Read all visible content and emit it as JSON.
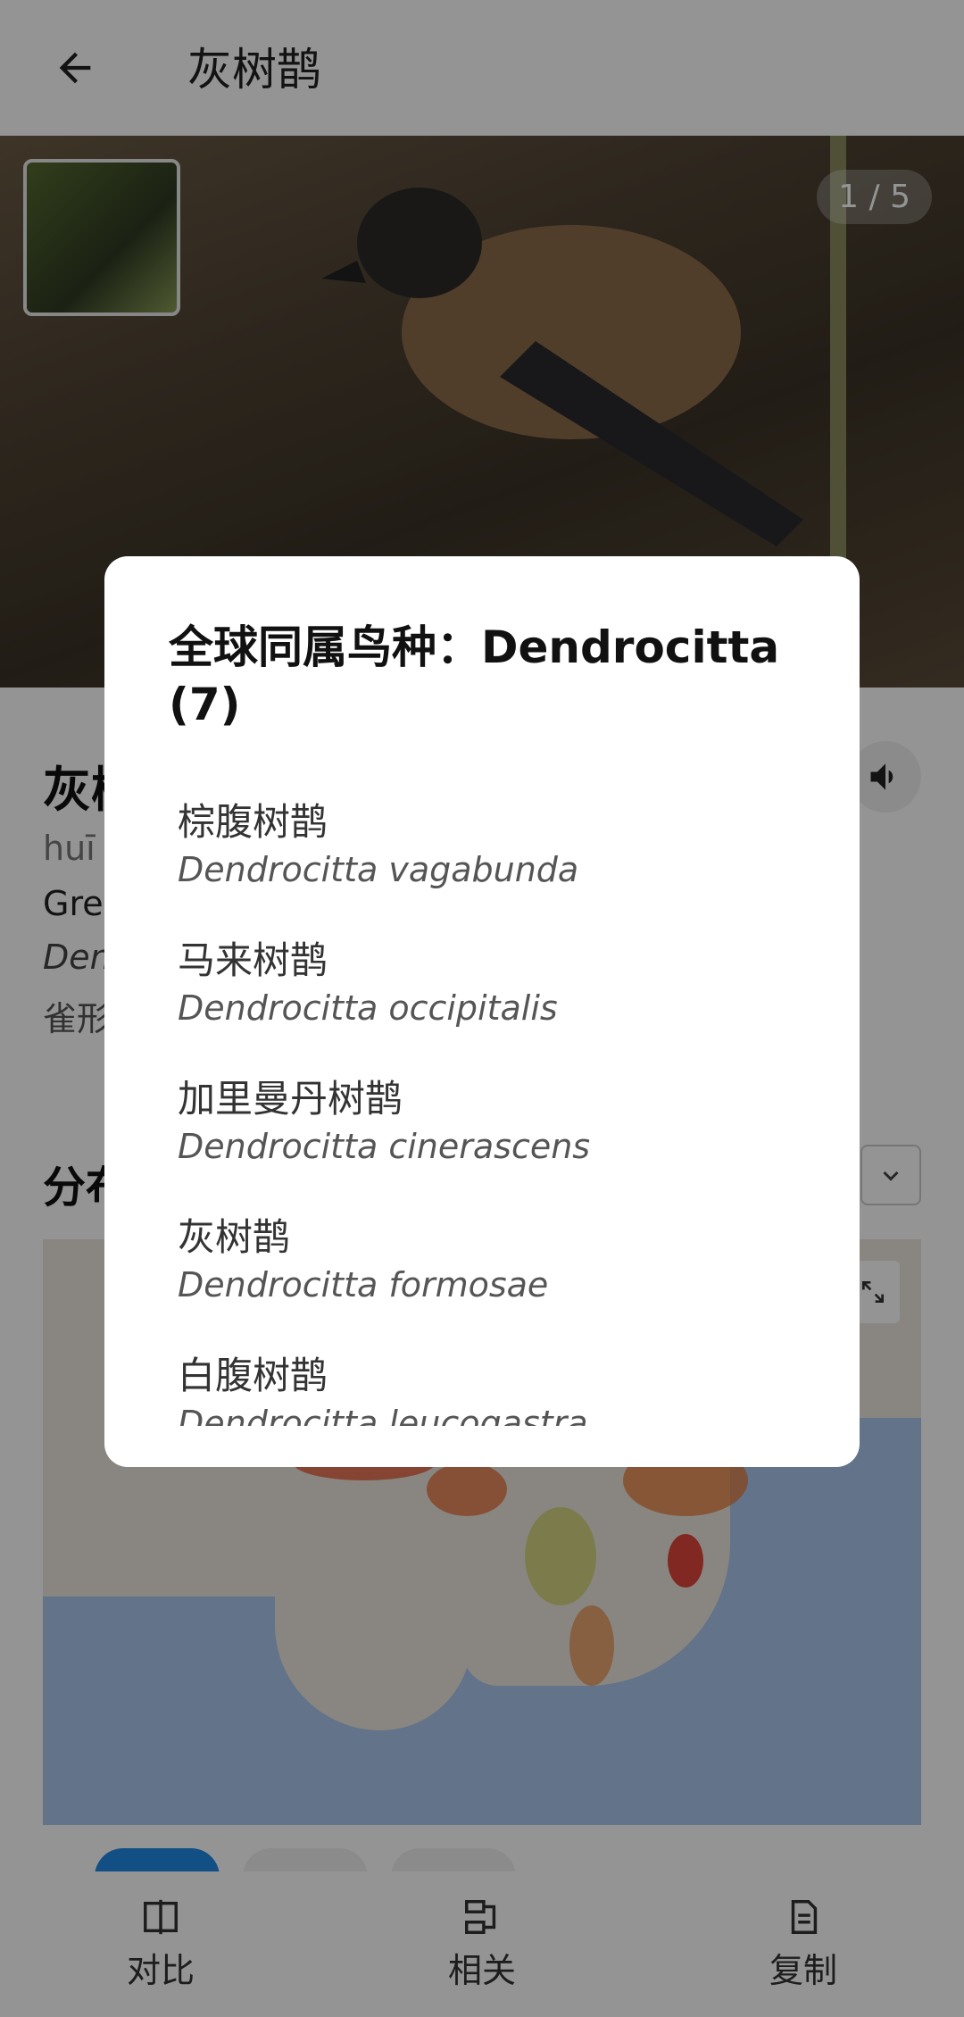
{
  "appbar": {
    "title": "灰树鹊"
  },
  "hero": {
    "counter": "1 / 5"
  },
  "info": {
    "name": "灰树",
    "pinyin": "huī",
    "english": "Grey",
    "latin": "Den",
    "order": "雀形"
  },
  "distribution": {
    "title": "分布"
  },
  "bottom_nav": [
    {
      "label": "对比",
      "icon": "compare-icon"
    },
    {
      "label": "相关",
      "icon": "related-icon"
    },
    {
      "label": "复制",
      "icon": "copy-icon"
    }
  ],
  "dialog": {
    "title": "全球同属鸟种：Dendrocitta (7)",
    "items": [
      {
        "cn": "棕腹树鹊",
        "latin": "Dendrocitta vagabunda"
      },
      {
        "cn": "马来树鹊",
        "latin": "Dendrocitta occipitalis"
      },
      {
        "cn": "加里曼丹树鹊",
        "latin": "Dendrocitta cinerascens"
      },
      {
        "cn": "灰树鹊",
        "latin": "Dendrocitta formosae"
      },
      {
        "cn": "白腹树鹊",
        "latin": "Dendrocitta leucogastra"
      }
    ]
  },
  "colors": {
    "accent": "#1e88e5",
    "scrim": "rgba(0,0,0,0.42)"
  }
}
